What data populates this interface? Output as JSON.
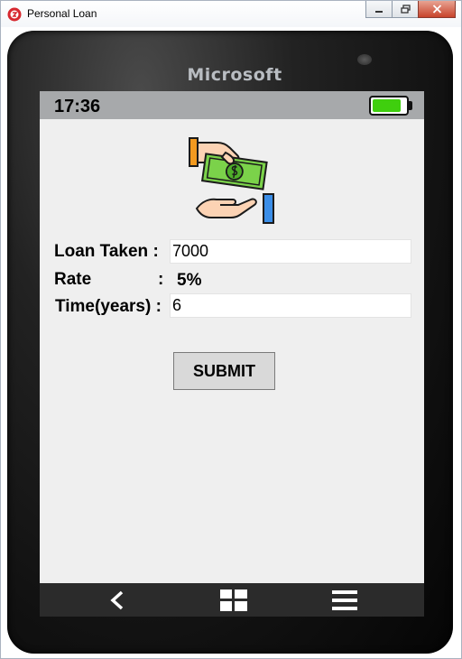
{
  "window": {
    "title": "Personal Loan",
    "controls": {
      "minimize": "minimize-icon",
      "restore": "restore-icon",
      "close": "close-icon"
    }
  },
  "phone": {
    "brand": "Microsoft",
    "status_bar": {
      "time": "17:36",
      "battery_level": 0.85,
      "battery_color": "#3fcf0e"
    }
  },
  "form": {
    "loan_taken": {
      "label": "Loan Taken :",
      "value": "7000"
    },
    "rate": {
      "label": "Rate",
      "separator": ":",
      "value": "5%"
    },
    "time": {
      "label": "Time(years) :",
      "value": "6"
    },
    "submit_label": "SUBMIT"
  },
  "nav": {
    "back": "back-icon",
    "home": "windows-icon",
    "menu": "menu-icon"
  },
  "colors": {
    "screen_bg": "#efefef",
    "status_bar_bg": "#a7a9ab",
    "nav_bg": "#2b2b2b",
    "button_bg": "#d9d9d9"
  }
}
